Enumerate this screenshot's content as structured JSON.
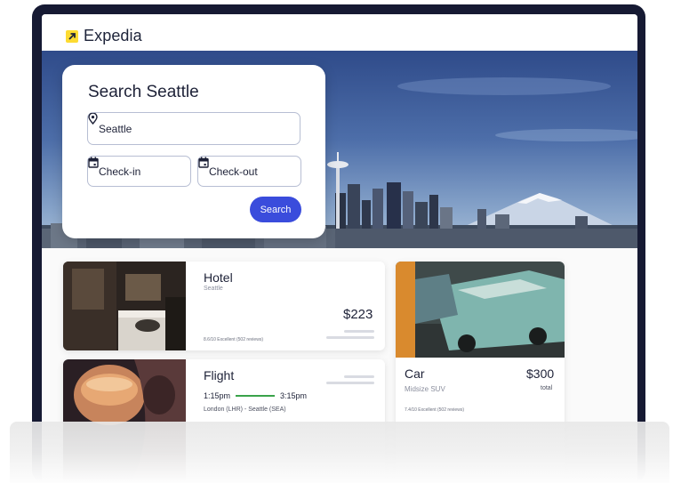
{
  "brand": {
    "name": "Expedia",
    "logo_color": "#fddb32"
  },
  "search": {
    "title": "Search Seattle",
    "destination": "Seattle",
    "checkin_label": "Check-in",
    "checkout_label": "Check-out",
    "button_label": "Search",
    "accent": "#3a4cdc"
  },
  "results": {
    "hotel": {
      "title": "Hotel",
      "subtitle": "Seattle",
      "price": "$223",
      "rating": "8.6/10 Excellent (502 reviews)"
    },
    "flight": {
      "title": "Flight",
      "depart": "1:15pm",
      "arrive": "3:15pm",
      "route": "London (LHR) - Seattle (SEA)"
    },
    "car": {
      "title": "Car",
      "subtitle": "Midsize SUV",
      "price": "$300",
      "price_note": "total",
      "rating": "7.4/10 Excellent (502 reviews)"
    }
  },
  "icons": [
    "location-pin-icon",
    "calendar-icon",
    "arrow-up-right-icon"
  ]
}
